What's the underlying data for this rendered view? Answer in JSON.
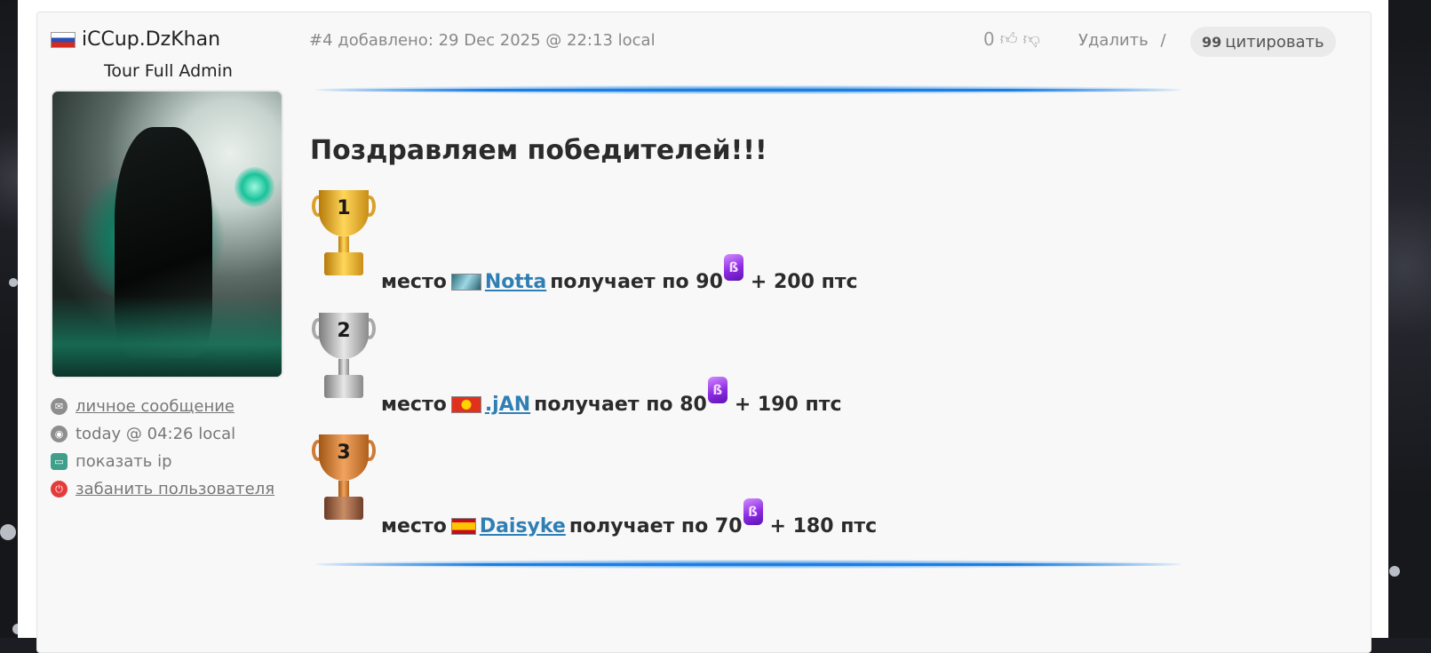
{
  "post": {
    "author": {
      "name": "iCCup.DzKhan",
      "role": "Tour Full Admin",
      "actions": {
        "message": "личное сообщение",
        "last_seen": "today @ 04:26 local",
        "show_ip": "показать ip",
        "ban": "забанить пользователя"
      }
    },
    "meta": "#4 добавлено: 29 Dec 2025 @ 22:13 local",
    "rating": "0",
    "delete_label": "Удалить",
    "delete_sep": "/",
    "quote_label": "цитировать",
    "quote_glyph": "99",
    "content": {
      "title": "Поздравляем победителей!!!",
      "place_word": "место",
      "gets_word": "получает по",
      "places": [
        {
          "rank": "1",
          "player": "Notta",
          "amount": "90",
          "bonus": "+ 200 птс"
        },
        {
          "rank": "2",
          "player": ".jAN",
          "amount": "80",
          "bonus": "+ 190 птс"
        },
        {
          "rank": "3",
          "player": "Daisyke",
          "amount": "70",
          "bonus": "+ 180 птс"
        }
      ],
      "coin_glyph": "ß"
    }
  },
  "colors": {
    "accent_link": "#2f7fb4",
    "divider_blue": "#1c7ee0",
    "coin_purple": "#8d2be2",
    "gold": "#ffd65a",
    "silver": "#e7e7e7",
    "bronze": "#f1a35e"
  },
  "icons": {
    "message": "envelope-icon",
    "last_seen": "clock-icon",
    "show_ip": "monitor-icon",
    "ban": "power-icon",
    "like": "thumbs-up-icon",
    "dislike": "thumbs-down-icon"
  }
}
